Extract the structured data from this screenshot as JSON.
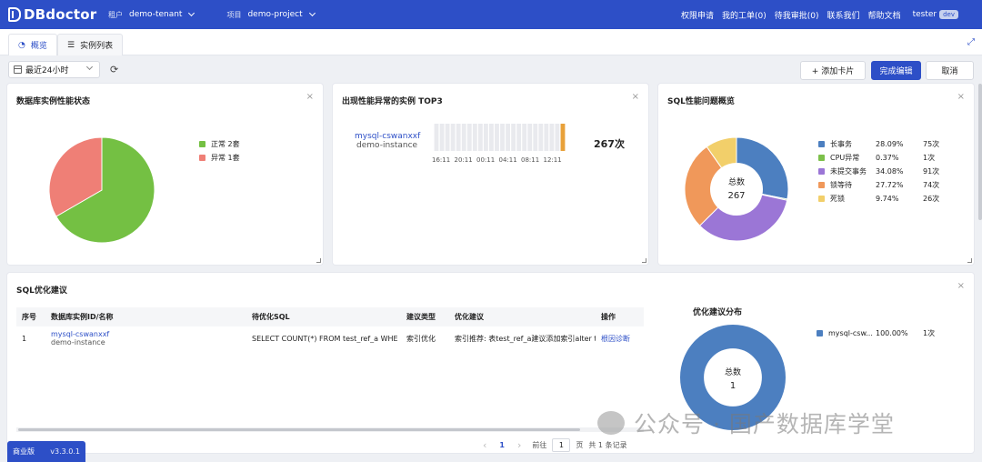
{
  "header": {
    "logo_text": "DBdoctor",
    "tenant_label": "租户",
    "tenant_value": "demo-tenant",
    "project_label": "项目",
    "project_value": "demo-project",
    "nav": [
      "权限申请",
      "我的工单(0)",
      "待我审批(0)",
      "联系我们",
      "帮助文档"
    ],
    "user_name": "tester",
    "user_badge": "dev"
  },
  "tabs": [
    {
      "label": "概览",
      "icon": "dashboard-icon",
      "active": true
    },
    {
      "label": "实例列表",
      "icon": "list-icon",
      "active": false
    }
  ],
  "toolbar": {
    "time_range": "最近24小时",
    "add_card_label": "+ 添加卡片",
    "done_label": "完成编辑",
    "cancel_label": "取消"
  },
  "cards": {
    "status": {
      "title": "数据库实例性能状态",
      "legend": [
        {
          "label": "正常 2套",
          "color": "#74c043",
          "value": 2
        },
        {
          "label": "异常 1套",
          "color": "#ef7f76",
          "value": 1
        }
      ]
    },
    "top3": {
      "title": "出现性能异常的实例 TOP3",
      "instance_id": "mysql-cswanxxf",
      "instance_name": "demo-instance",
      "count_label": "267次",
      "tick_labels": [
        "16:11",
        "20:11",
        "00:11",
        "04:11",
        "08:11",
        "12:11"
      ],
      "bar_count": 24,
      "highlight_index": 23,
      "highlight_color": "#e8a13a"
    },
    "sql_overview": {
      "title": "SQL性能问题概览",
      "center_label": "总数",
      "center_value": "267",
      "rows": [
        {
          "name": "长事务",
          "pct": "28.09%",
          "count": "75次",
          "color": "#4c7fc0",
          "value": 75
        },
        {
          "name": "CPU异常",
          "pct": "0.37%",
          "count": "1次",
          "color": "#7cc04a",
          "value": 1
        },
        {
          "name": "未提交事务",
          "pct": "34.08%",
          "count": "91次",
          "color": "#9b76d6",
          "value": 91
        },
        {
          "name": "锁等待",
          "pct": "27.72%",
          "count": "74次",
          "color": "#f0985a",
          "value": 74
        },
        {
          "name": "死锁",
          "pct": "9.74%",
          "count": "26次",
          "color": "#f2cf6a",
          "value": 26
        }
      ]
    },
    "sql_suggest": {
      "title": "SQL优化建议",
      "columns": [
        "序号",
        "数据库实例ID/名称",
        "待优化SQL",
        "建议类型",
        "优化建议",
        "操作"
      ],
      "rows": [
        {
          "no": "1",
          "instance_id": "mysql-cswanxxf",
          "instance_name": "demo-instance",
          "sql": "SELECT COUNT(*) FROM test_ref_a WHE",
          "type": "索引优化",
          "advice": "索引推荐: 表test_ref_a建议添加索引alter ta",
          "action": "根因诊断"
        }
      ],
      "pager": {
        "prev": "‹",
        "page": "1",
        "next": "›",
        "goto_label": "前往",
        "goto_value": "1",
        "page_unit": "页",
        "total": "共 1 条记录"
      },
      "dist": {
        "title": "优化建议分布",
        "center_label": "总数",
        "center_value": "1",
        "rows": [
          {
            "name": "mysql-csw...",
            "pct": "100.00%",
            "count": "1次",
            "color": "#4c7fc0"
          }
        ]
      }
    }
  },
  "watermark": "公众号 · 国产数据库学堂",
  "edition": {
    "name": "商业版",
    "version": "v3.3.0.1"
  }
}
